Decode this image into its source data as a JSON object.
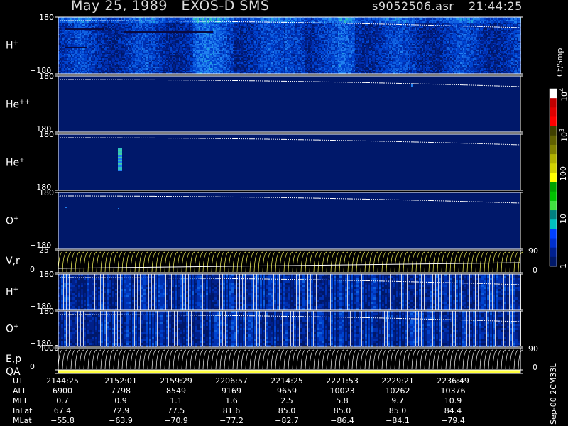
{
  "header": {
    "title": "May 25, 1989   EXOS-D SMS",
    "file": "s9052506.asr",
    "time": "21:44:25"
  },
  "colorbar": {
    "unit": "Ct/Smp",
    "ticks": [
      "10",
      "10",
      "100",
      "10",
      "1"
    ],
    "tick_sup": [
      "4",
      "3",
      "",
      "",
      ""
    ],
    "colors": [
      "#ffffff",
      "#c00000",
      "#e00000",
      "#ff0000",
      "#404000",
      "#606000",
      "#808000",
      "#b0b000",
      "#d0d000",
      "#ffff00",
      "#00a000",
      "#00c000",
      "#40e040",
      "#008080",
      "#00c0c0",
      "#0040ff",
      "#0030d0",
      "#002090",
      "#001868"
    ]
  },
  "footer_right": "Sep-00  2CM33L",
  "chart_data": {
    "type": "heatmap",
    "panels": [
      {
        "label": "H",
        "sup": "+",
        "ymax": "180",
        "ymin": "−180",
        "intensity": "high"
      },
      {
        "label": "He",
        "sup": "++",
        "ymax": "180",
        "ymin": "−180",
        "intensity": "low"
      },
      {
        "label": "He",
        "sup": "+",
        "ymax": "180",
        "ymin": "−180",
        "intensity": "low"
      },
      {
        "label": "O",
        "sup": "+",
        "ymax": "180",
        "ymin": "−180",
        "intensity": "low"
      },
      {
        "label": "V,r",
        "sup": "",
        "ymax": "25",
        "ymin": "0",
        "right_max": "90",
        "right_min": "0",
        "intensity": "line"
      },
      {
        "label": "H",
        "sup": "+",
        "ymax": "180",
        "ymin": "−180",
        "intensity": "medium"
      },
      {
        "label": "O",
        "sup": "+",
        "ymax": "180",
        "ymin": "−180",
        "intensity": "medium"
      },
      {
        "label": "E,p",
        "sup": "",
        "ymax": "4000",
        "ymin": "0",
        "right_max": "90",
        "right_min": "0",
        "intensity": "line"
      },
      {
        "label": "QA",
        "sup": "",
        "ymax": "",
        "ymin": "",
        "intensity": "qa"
      }
    ],
    "orbit_table": {
      "rows": [
        {
          "name": "UT",
          "values": [
            "2144:25",
            "2152:01",
            "2159:29",
            "2206:57",
            "2214:25",
            "2221:53",
            "2229:21",
            "2236:49"
          ]
        },
        {
          "name": "ALT",
          "values": [
            "6900",
            "7798",
            "8549",
            "9169",
            "9659",
            "10023",
            "10262",
            "10376"
          ]
        },
        {
          "name": "MLT",
          "values": [
            "0.7",
            "0.9",
            "1.1",
            "1.6",
            "2.5",
            "5.8",
            "9.7",
            "10.9"
          ]
        },
        {
          "name": "InLat",
          "values": [
            "67.4",
            "72.9",
            "77.5",
            "81.6",
            "85.0",
            "85.0",
            "85.0",
            "84.4"
          ]
        },
        {
          "name": "MLat",
          "values": [
            "−55.8",
            "−63.9",
            "−70.9",
            "−77.2",
            "−82.7",
            "−86.4",
            "−84.1",
            "−79.4"
          ]
        }
      ]
    }
  }
}
